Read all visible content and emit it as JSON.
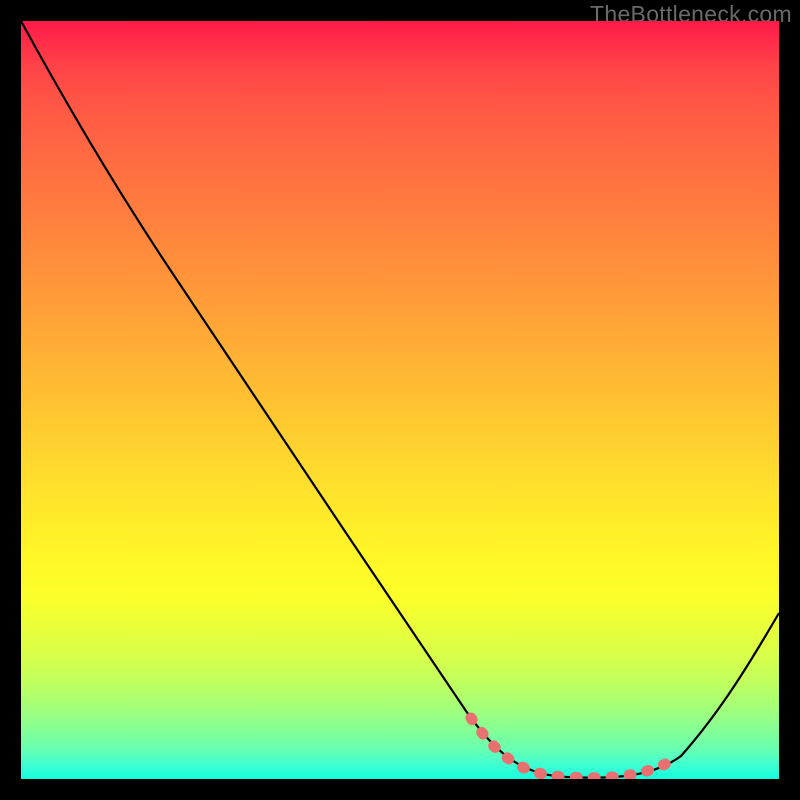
{
  "watermark": "TheBottleneck.com",
  "colors": {
    "gradient_top": "#ff1a49",
    "gradient_mid": "#fff527",
    "gradient_bottom": "#12ffde",
    "curve": "#000000",
    "highlight": "#e87070",
    "frame": "#000000"
  },
  "chart_data": {
    "type": "line",
    "title": "",
    "xlabel": "",
    "ylabel": "",
    "xlim": [
      0,
      100
    ],
    "ylim": [
      0,
      100
    ],
    "note": "Axes are unlabeled in the source image; x/y expressed as 0-100 percent of plot width/height, y measured from bottom.",
    "series": [
      {
        "name": "bottleneck-curve",
        "stroke": "#000000",
        "x": [
          0,
          8,
          15,
          20,
          30,
          40,
          50,
          59,
          66,
          72,
          78,
          83,
          87,
          92,
          96,
          100
        ],
        "y": [
          100,
          86,
          75,
          67,
          52,
          38,
          25,
          12,
          4,
          1,
          0,
          0,
          2,
          8,
          15,
          22
        ]
      },
      {
        "name": "optimal-region-highlight",
        "stroke": "#e87070",
        "style": "dotted",
        "x": [
          59,
          63,
          67,
          71,
          75,
          79,
          83,
          86
        ],
        "y": [
          8,
          4,
          2,
          1,
          0,
          0,
          1,
          3
        ]
      }
    ]
  }
}
